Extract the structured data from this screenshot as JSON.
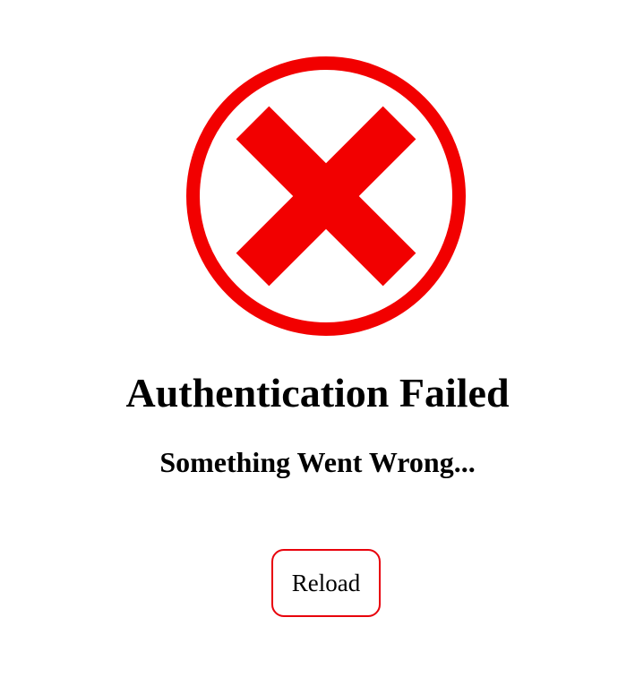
{
  "error_icon": {
    "name": "error-x-circle-icon",
    "color": "#f20000"
  },
  "message": {
    "title": "Authentication Failed",
    "subtitle": "Something Went Wrong..."
  },
  "actions": {
    "reload_label": "Reload",
    "button_border_color": "#e8000b"
  }
}
